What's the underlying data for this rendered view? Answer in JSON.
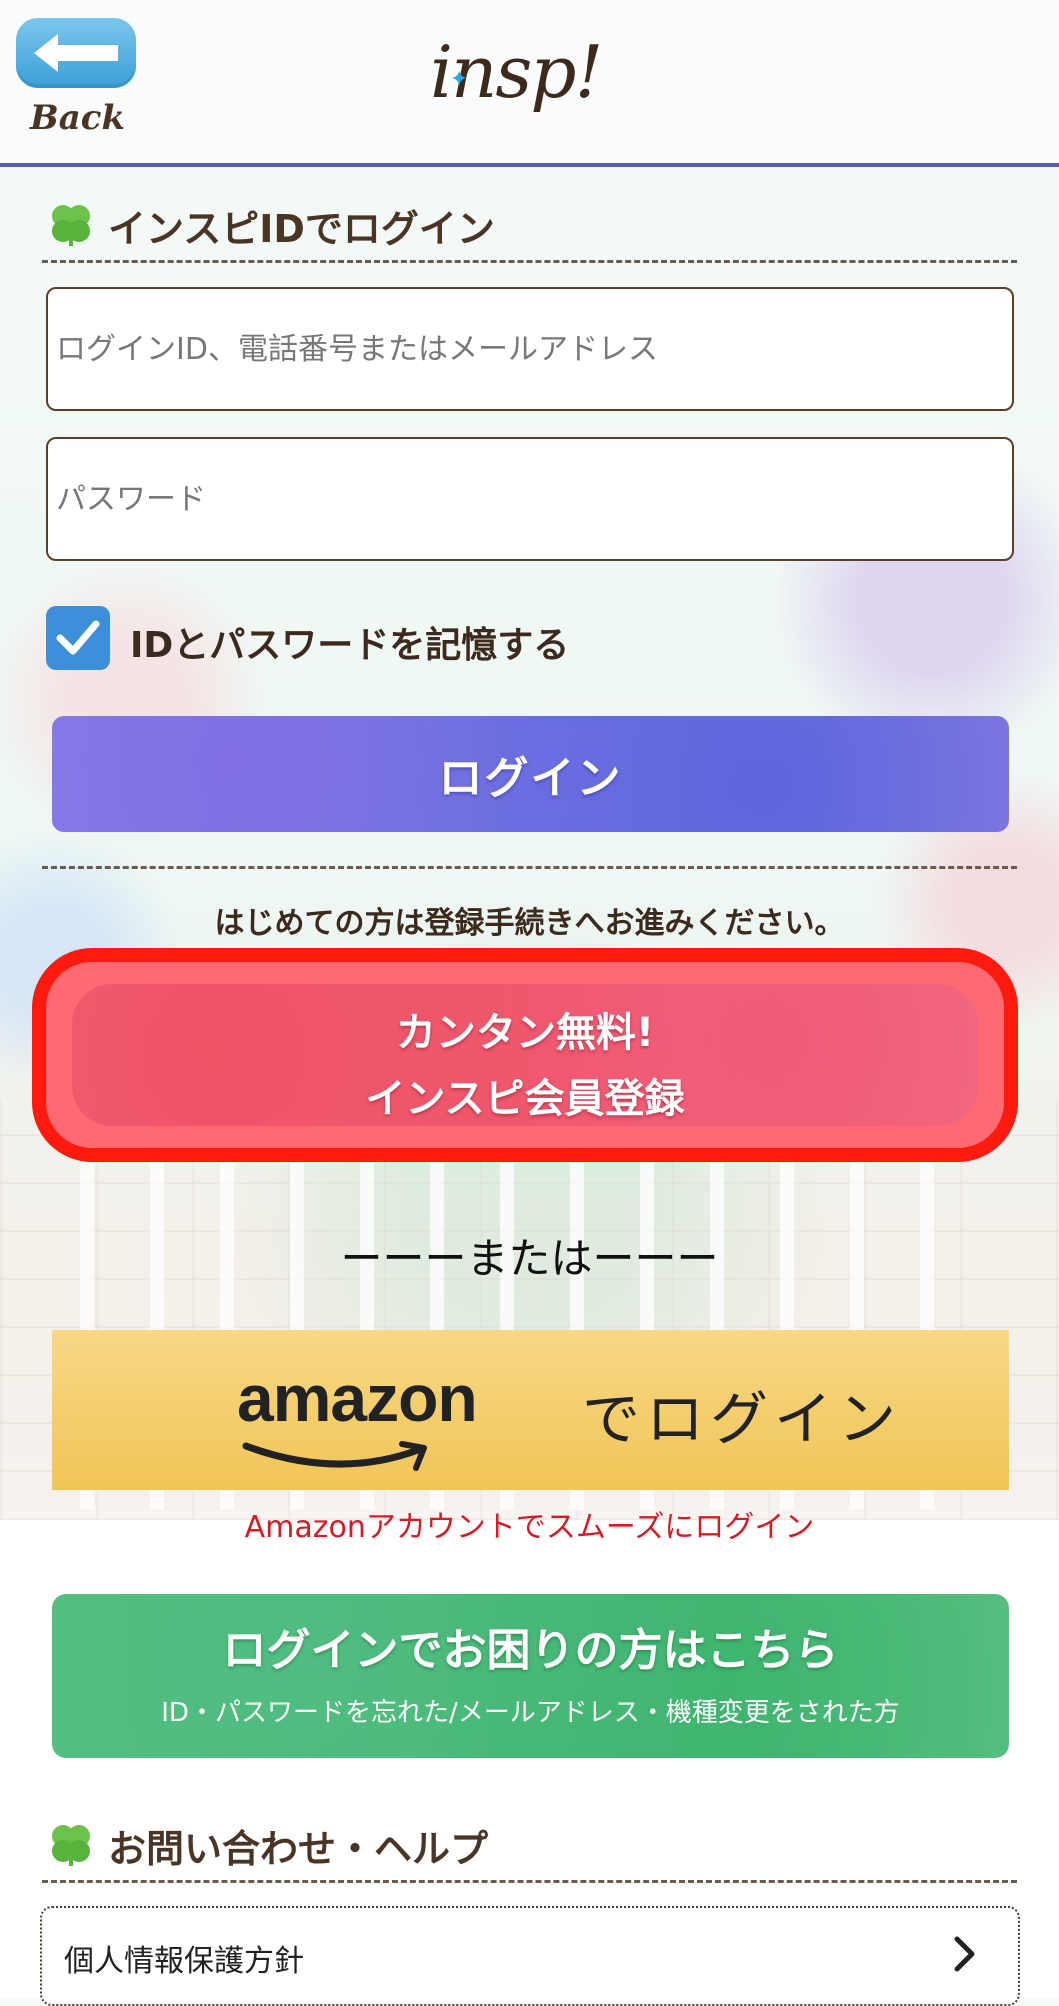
{
  "header": {
    "back_label": "Back",
    "logo_text": "insp!"
  },
  "login_section": {
    "title": "インスピIDでログイン",
    "id_placeholder": "ログインID、電話番号またはメールアドレス",
    "password_placeholder": "パスワード",
    "remember_label": "IDとパスワードを記憶する",
    "remember_checked": true,
    "login_button": "ログイン"
  },
  "register": {
    "guide_text": "はじめての方は登録手続きへお進みください。",
    "button_line1": "カンタン無料!",
    "button_line2": "インスピ会員登録"
  },
  "or_text": "ーーーまたはーーー",
  "amazon": {
    "brand": "amazon",
    "button_text": "でログイン",
    "note": "Amazonアカウントでスムーズにログイン"
  },
  "help_button": {
    "title": "ログインでお困りの方はこちら",
    "subtitle": "ID・パスワードを忘れた/メールアドレス・機種変更をされた方"
  },
  "help_section": {
    "title": "お問い合わせ・ヘルプ",
    "items": [
      {
        "label": "個人情報保護方針"
      }
    ]
  },
  "colors": {
    "header_border": "#5b5ea8",
    "checkbox": "#3c8fd8",
    "register_highlight": "#ff1a10",
    "amazon_note": "#d31c24",
    "text_brown": "#4a3426"
  },
  "icons": {
    "back": "arrow-left-icon",
    "clover": "clover-icon",
    "check": "check-icon",
    "chevron": "chevron-right-icon",
    "amazon_smile": "amazon-smile-icon"
  }
}
